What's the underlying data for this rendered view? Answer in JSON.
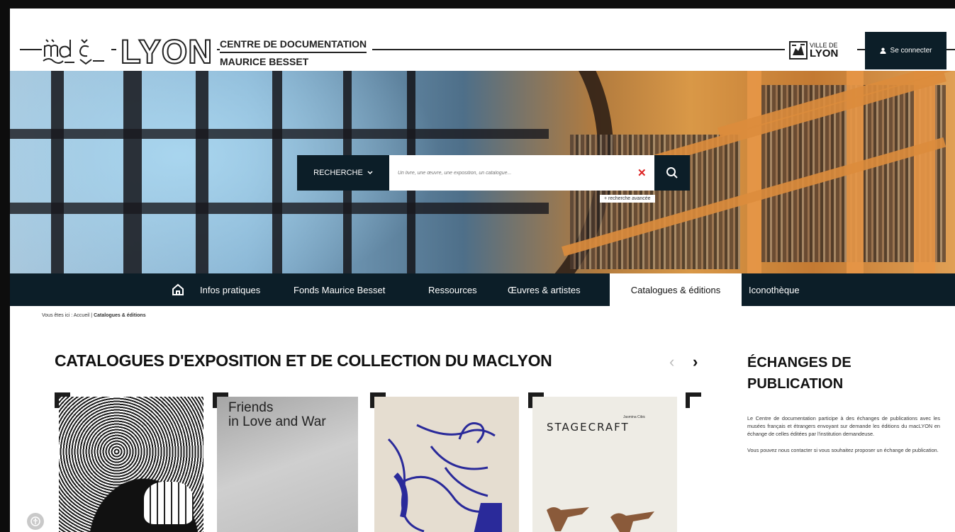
{
  "header": {
    "logo_text": "LYON",
    "centre_line1": "CENTRE DE DOCUMENTATION",
    "centre_line2": "MAURICE BESSET",
    "ville_small": "VILLE DE",
    "ville_big": "LYON",
    "connect_label": "Se connecter"
  },
  "search": {
    "select_label": "RECHERCHE",
    "placeholder": "Un livre, une œuvre, une exposition, un catalogue...",
    "advanced_label": "+ recherche avancée"
  },
  "nav": {
    "items": [
      {
        "label": "Infos pratiques",
        "active": false
      },
      {
        "label": "Fonds Maurice Besset",
        "active": false
      },
      {
        "label": "Ressources",
        "active": false
      },
      {
        "label": "Œuvres & artistes",
        "active": false
      },
      {
        "label": "Catalogues & éditions",
        "active": true
      },
      {
        "label": "Iconothèque",
        "active": false
      }
    ]
  },
  "breadcrumb": {
    "prefix": "Vous êtes ici :",
    "home": "Accueil",
    "separator": "|",
    "current": "Catalogues & éditions"
  },
  "main": {
    "section_title": "CATALOGUES D'EXPOSITION ET DE COLLECTION DU MACLYON",
    "cards": [
      {
        "title": ""
      },
      {
        "title_line1": "Friends",
        "title_line2": "in Love and War"
      },
      {
        "title": ""
      },
      {
        "title": "STAGECRAFT",
        "author": "Jasmina Cibic"
      }
    ]
  },
  "aside": {
    "title": "ÉCHANGES DE PUBLICATION",
    "paragraph1": "Le Centre de documentation participe à des échanges de publications avec les musées français et étrangers envoyant sur demande les éditions du macLYON en échange de celles éditées par l'institution demandeuse.",
    "paragraph2": "Vous pouvez nous contacter si vous souhaitez proposer un échange de publication."
  },
  "colors": {
    "dark_navy": "#0c1e28",
    "clear_red": "#d22222"
  }
}
